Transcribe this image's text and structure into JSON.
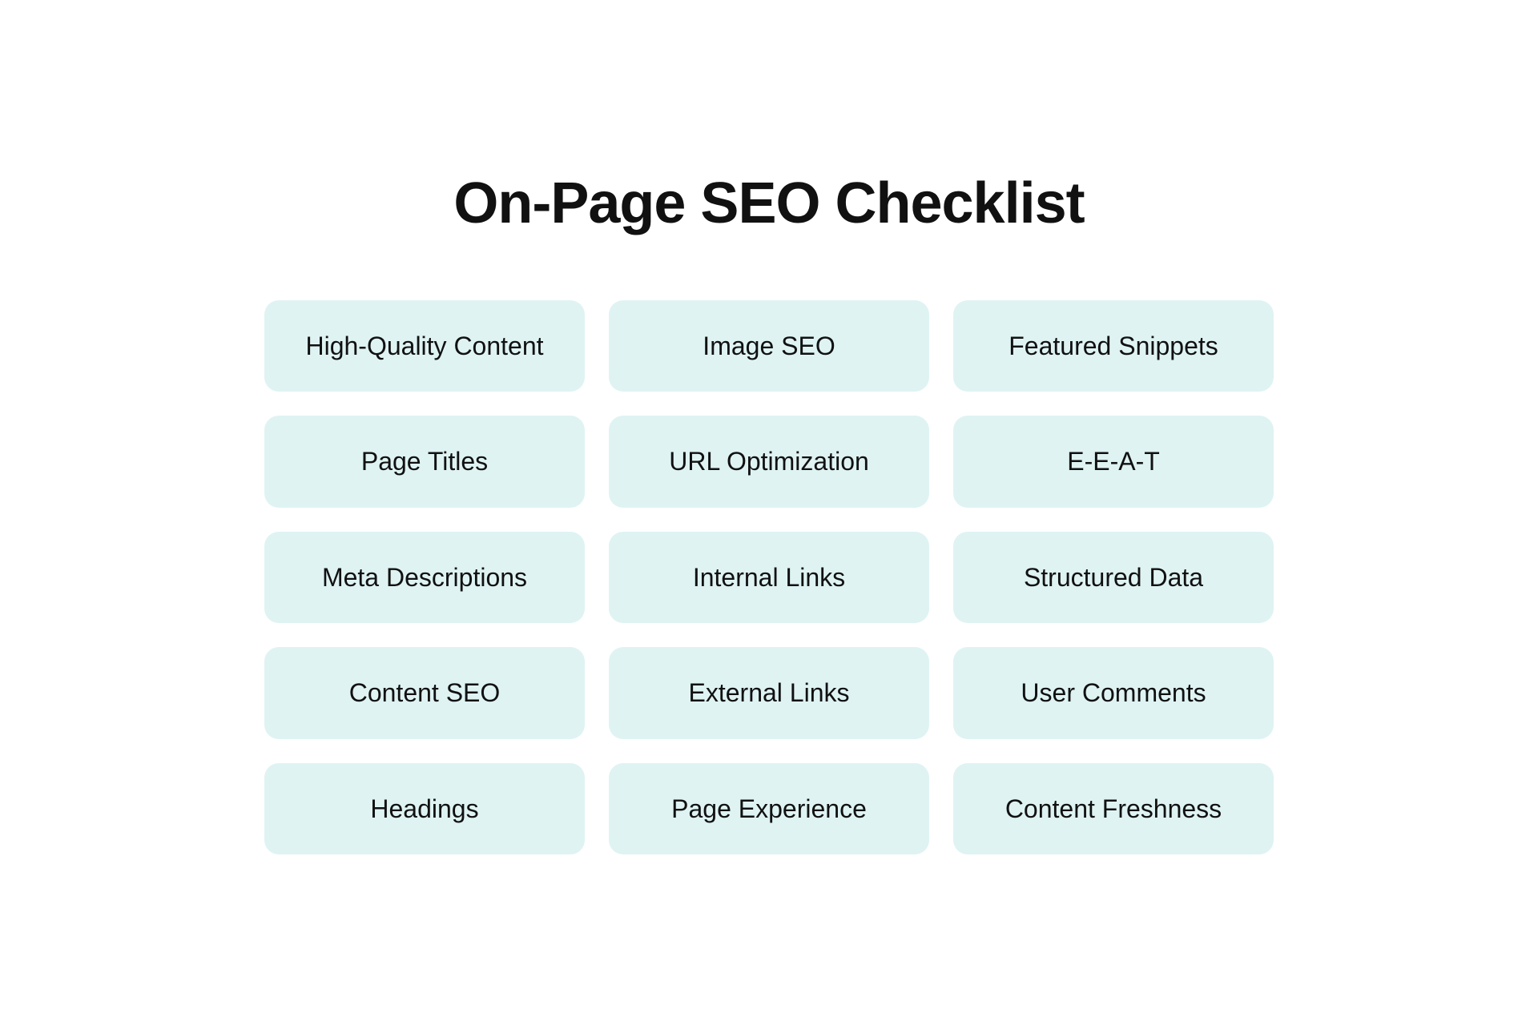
{
  "page": {
    "title": "On-Page SEO Checklist"
  },
  "items": [
    {
      "label": "High-Quality Content"
    },
    {
      "label": "Image SEO"
    },
    {
      "label": "Featured Snippets"
    },
    {
      "label": "Page Titles"
    },
    {
      "label": "URL Optimization"
    },
    {
      "label": "E-E-A-T"
    },
    {
      "label": "Meta Descriptions"
    },
    {
      "label": "Internal Links"
    },
    {
      "label": "Structured Data"
    },
    {
      "label": "Content SEO"
    },
    {
      "label": "External Links"
    },
    {
      "label": "User Comments"
    },
    {
      "label": "Headings"
    },
    {
      "label": "Page Experience"
    },
    {
      "label": "Content Freshness"
    }
  ]
}
